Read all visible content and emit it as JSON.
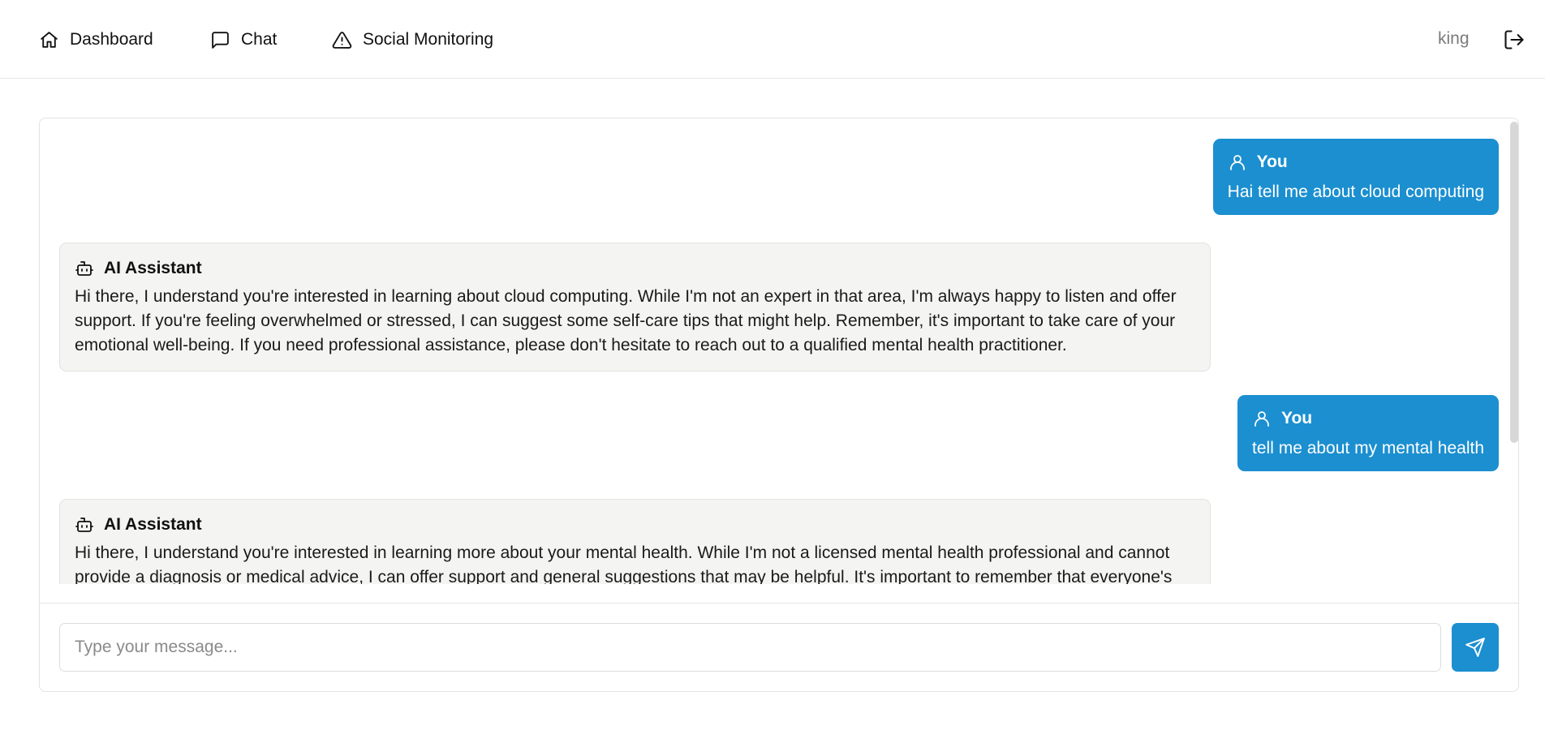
{
  "nav": {
    "items": [
      {
        "label": "Dashboard",
        "icon": "home-icon"
      },
      {
        "label": "Chat",
        "icon": "message-square-icon"
      },
      {
        "label": "Social Monitoring",
        "icon": "alert-triangle-icon"
      }
    ],
    "username": "king",
    "logout_icon": "logout-icon"
  },
  "chat": {
    "messages": [
      {
        "role": "user",
        "author": "You",
        "text": "Hai tell me about cloud computing"
      },
      {
        "role": "assistant",
        "author": "AI Assistant",
        "text": "Hi there, I understand you're interested in learning about cloud computing. While I'm not an expert in that area, I'm always happy to listen and offer support. If you're feeling overwhelmed or stressed, I can suggest some self-care tips that might help. Remember, it's important to take care of your emotional well-being. If you need professional assistance, please don't hesitate to reach out to a qualified mental health practitioner."
      },
      {
        "role": "user",
        "author": "You",
        "text": "tell me about my mental health"
      },
      {
        "role": "assistant",
        "author": "AI Assistant",
        "text": "Hi there, I understand you're interested in learning more about your mental health. While I'm not a licensed mental health professional and cannot provide a diagnosis or medical advice, I can offer support and general suggestions that may be helpful. It's important to remember that everyone's"
      }
    ],
    "input_placeholder": "Type your message...",
    "input_value": "",
    "send_icon": "send-icon"
  },
  "colors": {
    "accent": "#1b8fd0",
    "assistant_bubble": "#f4f4f2",
    "muted_text": "#7b7b7b"
  }
}
